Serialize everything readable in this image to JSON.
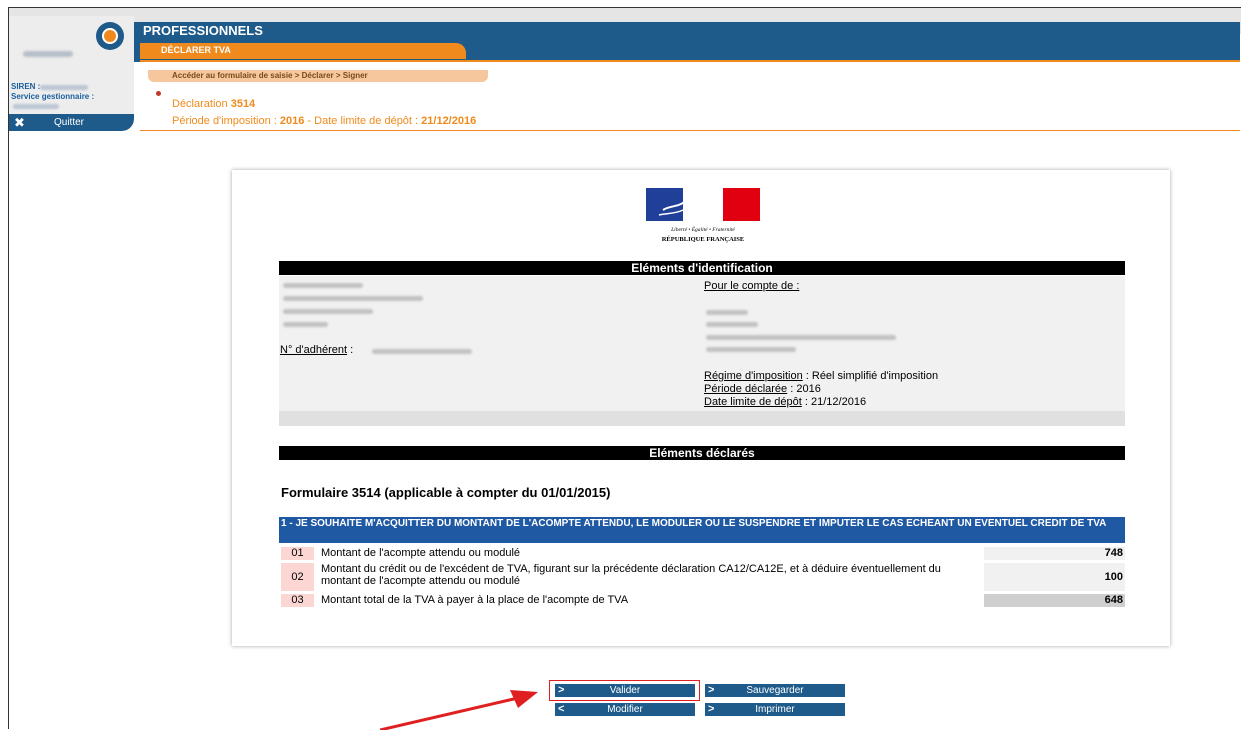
{
  "header": {
    "app_title": "PROFESSIONNELS",
    "active_tab": "DÉCLARER TVA",
    "breadcrumb": "Accéder au formulaire de saisie  >  Déclarer  >  Signer",
    "siren_label": "SIREN :",
    "service_label": "Service gestionnaire :",
    "quit_label": "Quitter"
  },
  "declaration": {
    "label": "Déclaration ",
    "number": "3514",
    "periode_label": "Période d'imposition : ",
    "periode_value": "2016",
    "limite_label": " - Date limite de dépôt : ",
    "limite_value": "21/12/2016"
  },
  "emblem": {
    "motto": "Liberté • Égalité • Fraternité",
    "republic": "RÉPUBLIQUE FRANÇAISE"
  },
  "identification": {
    "title": "Eléments d'identification",
    "compte_label": "Pour le compte de :",
    "adherent_label": "N° d'adhérent",
    "adherent_sep": " :",
    "regime_label": "Régime d'imposition",
    "regime_value": " : Réel simplifié d'imposition",
    "periode_label": "Période déclarée",
    "periode_value": " : 2016",
    "limite_label": "Date limite de dépôt",
    "limite_value": " : 21/12/2016"
  },
  "declared": {
    "title": "Eléments déclarés",
    "form_title": "Formulaire 3514 (applicable à compter du 01/01/2015)",
    "section_title": "1 - JE SOUHAITE M'ACQUITTER DU MONTANT DE L'ACOMPTE ATTENDU, LE MODULER OU LE SUSPENDRE ET IMPUTER LE CAS ECHEANT UN EVENTUEL CREDIT DE TVA",
    "rows": [
      {
        "num": "01",
        "label": "Montant de l'acompte attendu ou modulé",
        "value": "748"
      },
      {
        "num": "02",
        "label": "Montant du crédit ou de l'excédent de TVA, figurant sur la précédente déclaration CA12/CA12E, et à déduire éventuellement du montant de l'acompte attendu ou modulé",
        "value": "100"
      },
      {
        "num": "03",
        "label": "Montant total de la TVA à payer à la place de l'acompte de TVA",
        "value": "648"
      }
    ]
  },
  "buttons": {
    "valider": "Valider",
    "sauvegarder": "Sauvegarder",
    "modifier": "Modifier",
    "imprimer": "Imprimer"
  },
  "colors": {
    "brand_blue": "#1e5a8a",
    "accent_orange": "#f08a1c",
    "section_blue": "#1f58a3",
    "highlight_red": "#e02020"
  }
}
